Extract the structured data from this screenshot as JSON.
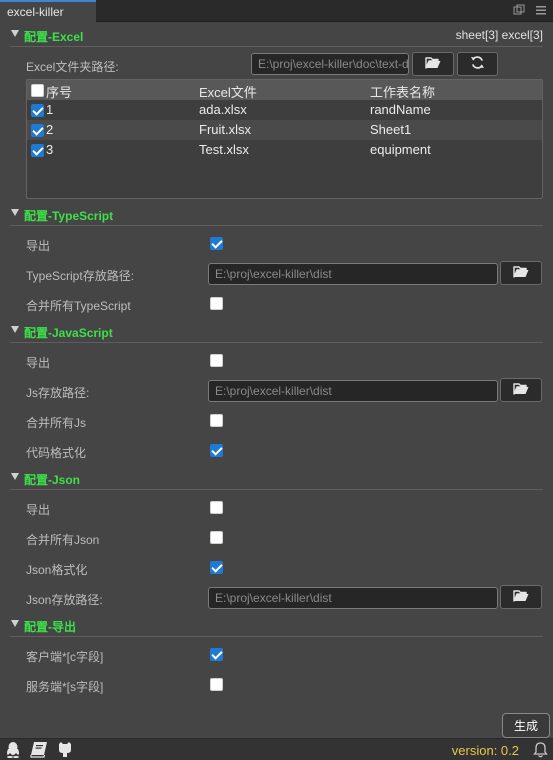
{
  "tab": {
    "title": "excel-killer"
  },
  "excel": {
    "section_title": "配置-Excel",
    "sheet_info": "sheet[3] excel[3]",
    "path_label": "Excel文件夹路径:",
    "path_value": "E:\\proj\\excel-killer\\doc\\text-d",
    "table": {
      "headers": [
        "序号",
        "Excel文件",
        "工作表名称"
      ],
      "rows": [
        {
          "index": "1",
          "file": "ada.xlsx",
          "sheet": "randName",
          "checked": true
        },
        {
          "index": "2",
          "file": "Fruit.xlsx",
          "sheet": "Sheet1",
          "checked": true
        },
        {
          "index": "3",
          "file": "Test.xlsx",
          "sheet": "equipment",
          "checked": true
        }
      ]
    }
  },
  "typescript": {
    "section_title": "配置-TypeScript",
    "export_label": "导出",
    "export_checked": true,
    "path_label": "TypeScript存放路径:",
    "path_value": "E:\\proj\\excel-killer\\dist",
    "merge_label": "合并所有TypeScript",
    "merge_checked": false
  },
  "javascript": {
    "section_title": "配置-JavaScript",
    "export_label": "导出",
    "export_checked": false,
    "path_label": "Js存放路径:",
    "path_value": "E:\\proj\\excel-killer\\dist",
    "merge_label": "合并所有Js",
    "merge_checked": false,
    "format_label": "代码格式化",
    "format_checked": true
  },
  "json": {
    "section_title": "配置-Json",
    "export_label": "导出",
    "export_checked": false,
    "merge_label": "合并所有Json",
    "merge_checked": false,
    "format_label": "Json格式化",
    "format_checked": true,
    "path_label": "Json存放路径:",
    "path_value": "E:\\proj\\excel-killer\\dist"
  },
  "export_cfg": {
    "section_title": "配置-导出",
    "client_label": "客户端*[c字段]",
    "client_checked": true,
    "server_label": "服务端*[s字段]",
    "server_checked": false
  },
  "generate_label": "生成",
  "status": {
    "version": "version: 0.2"
  },
  "icons": {
    "folder": "folder-open-icon",
    "refresh": "refresh-icon",
    "qq": "qq-icon",
    "book": "book-icon",
    "github": "github-icon",
    "bell": "bell-icon"
  },
  "colors": {
    "section_title": "#3ee04a",
    "checkbox_on": "#1e7ad2",
    "version": "#e8c84a"
  }
}
